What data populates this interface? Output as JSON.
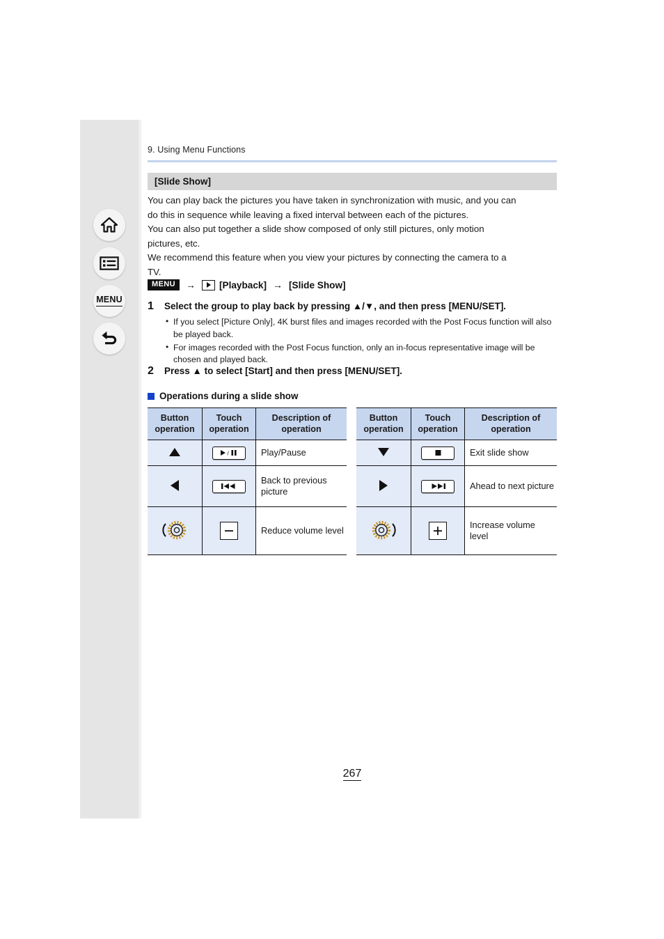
{
  "document": {
    "chapter_title": "9. Using Menu Functions",
    "section_title": "[Slide Show]",
    "page_number": "267"
  },
  "sidebar": {
    "items": [
      {
        "name": "home-icon",
        "label": ""
      },
      {
        "name": "contents-icon",
        "label": ""
      },
      {
        "name": "menu-icon",
        "label": "MENU"
      },
      {
        "name": "back-icon",
        "label": ""
      }
    ]
  },
  "intro": {
    "line1": "You can play back the pictures you have taken in synchronization with music, and you can",
    "line2": "do this in sequence while leaving a fixed interval between each of the pictures.",
    "line3": "You can also put together a slide show composed of only still pictures, only motion",
    "line4": "pictures, etc.",
    "line5": "We recommend this feature when you view your pictures by connecting the camera to a",
    "line6": "TV."
  },
  "menu_path": {
    "badge": "MENU",
    "arrow1": "→",
    "playback_label": "[Playback]",
    "arrow2": "→",
    "target_label": "[Slide Show]"
  },
  "steps": [
    {
      "number": "1",
      "text": "Select the group to play back by pressing ▲/▼, and then press [MENU/SET].",
      "bullets": [
        "If you select [Picture Only], 4K burst files and images recorded with the Post Focus function will also be played back.",
        "For images recorded with the Post Focus function, only an in-focus representative image will be chosen and played back."
      ]
    },
    {
      "number": "2",
      "text": "Press ▲ to select [Start] and then press [MENU/SET].",
      "bullets": []
    }
  ],
  "operations_heading": "Operations during a slide show",
  "tables": {
    "headers": [
      "Button operation",
      "Touch operation",
      "Description of operation"
    ],
    "header_lines": {
      "c1_l1": "Button",
      "c1_l2": "operation",
      "c2_l1": "Touch",
      "c2_l2": "operation",
      "c3_l1": "Description of",
      "c3_l2": "operation"
    },
    "left_rows": [
      {
        "button": "▲",
        "button_icon": "arrow-up-icon",
        "touch_icon": "play-pause-icon",
        "description": "Play/Pause"
      },
      {
        "button": "◀",
        "button_icon": "arrow-left-icon",
        "touch_icon": "previous-track-icon",
        "description": "Back to previous picture"
      },
      {
        "button": "",
        "button_icon": "dial-left-icon",
        "touch_icon": "minus-icon",
        "description": "Reduce volume level"
      }
    ],
    "right_rows": [
      {
        "button": "▼",
        "button_icon": "arrow-down-icon",
        "touch_icon": "stop-icon",
        "description": "Exit slide show"
      },
      {
        "button": "▶",
        "button_icon": "arrow-right-icon",
        "touch_icon": "next-track-icon",
        "description": "Ahead to next picture"
      },
      {
        "button": "",
        "button_icon": "dial-right-icon",
        "touch_icon": "plus-icon",
        "description": "Increase volume level"
      }
    ]
  },
  "colors": {
    "header_blue": "#c7d6ef",
    "cell_blue": "#e3eaf8",
    "rule_blue": "#c3d2ec",
    "section_gray": "#d6d6d6",
    "sidebar_gray": "#e5e5e5",
    "bullet_blue": "#1442c8",
    "dial_gold": "#d6a73a"
  }
}
